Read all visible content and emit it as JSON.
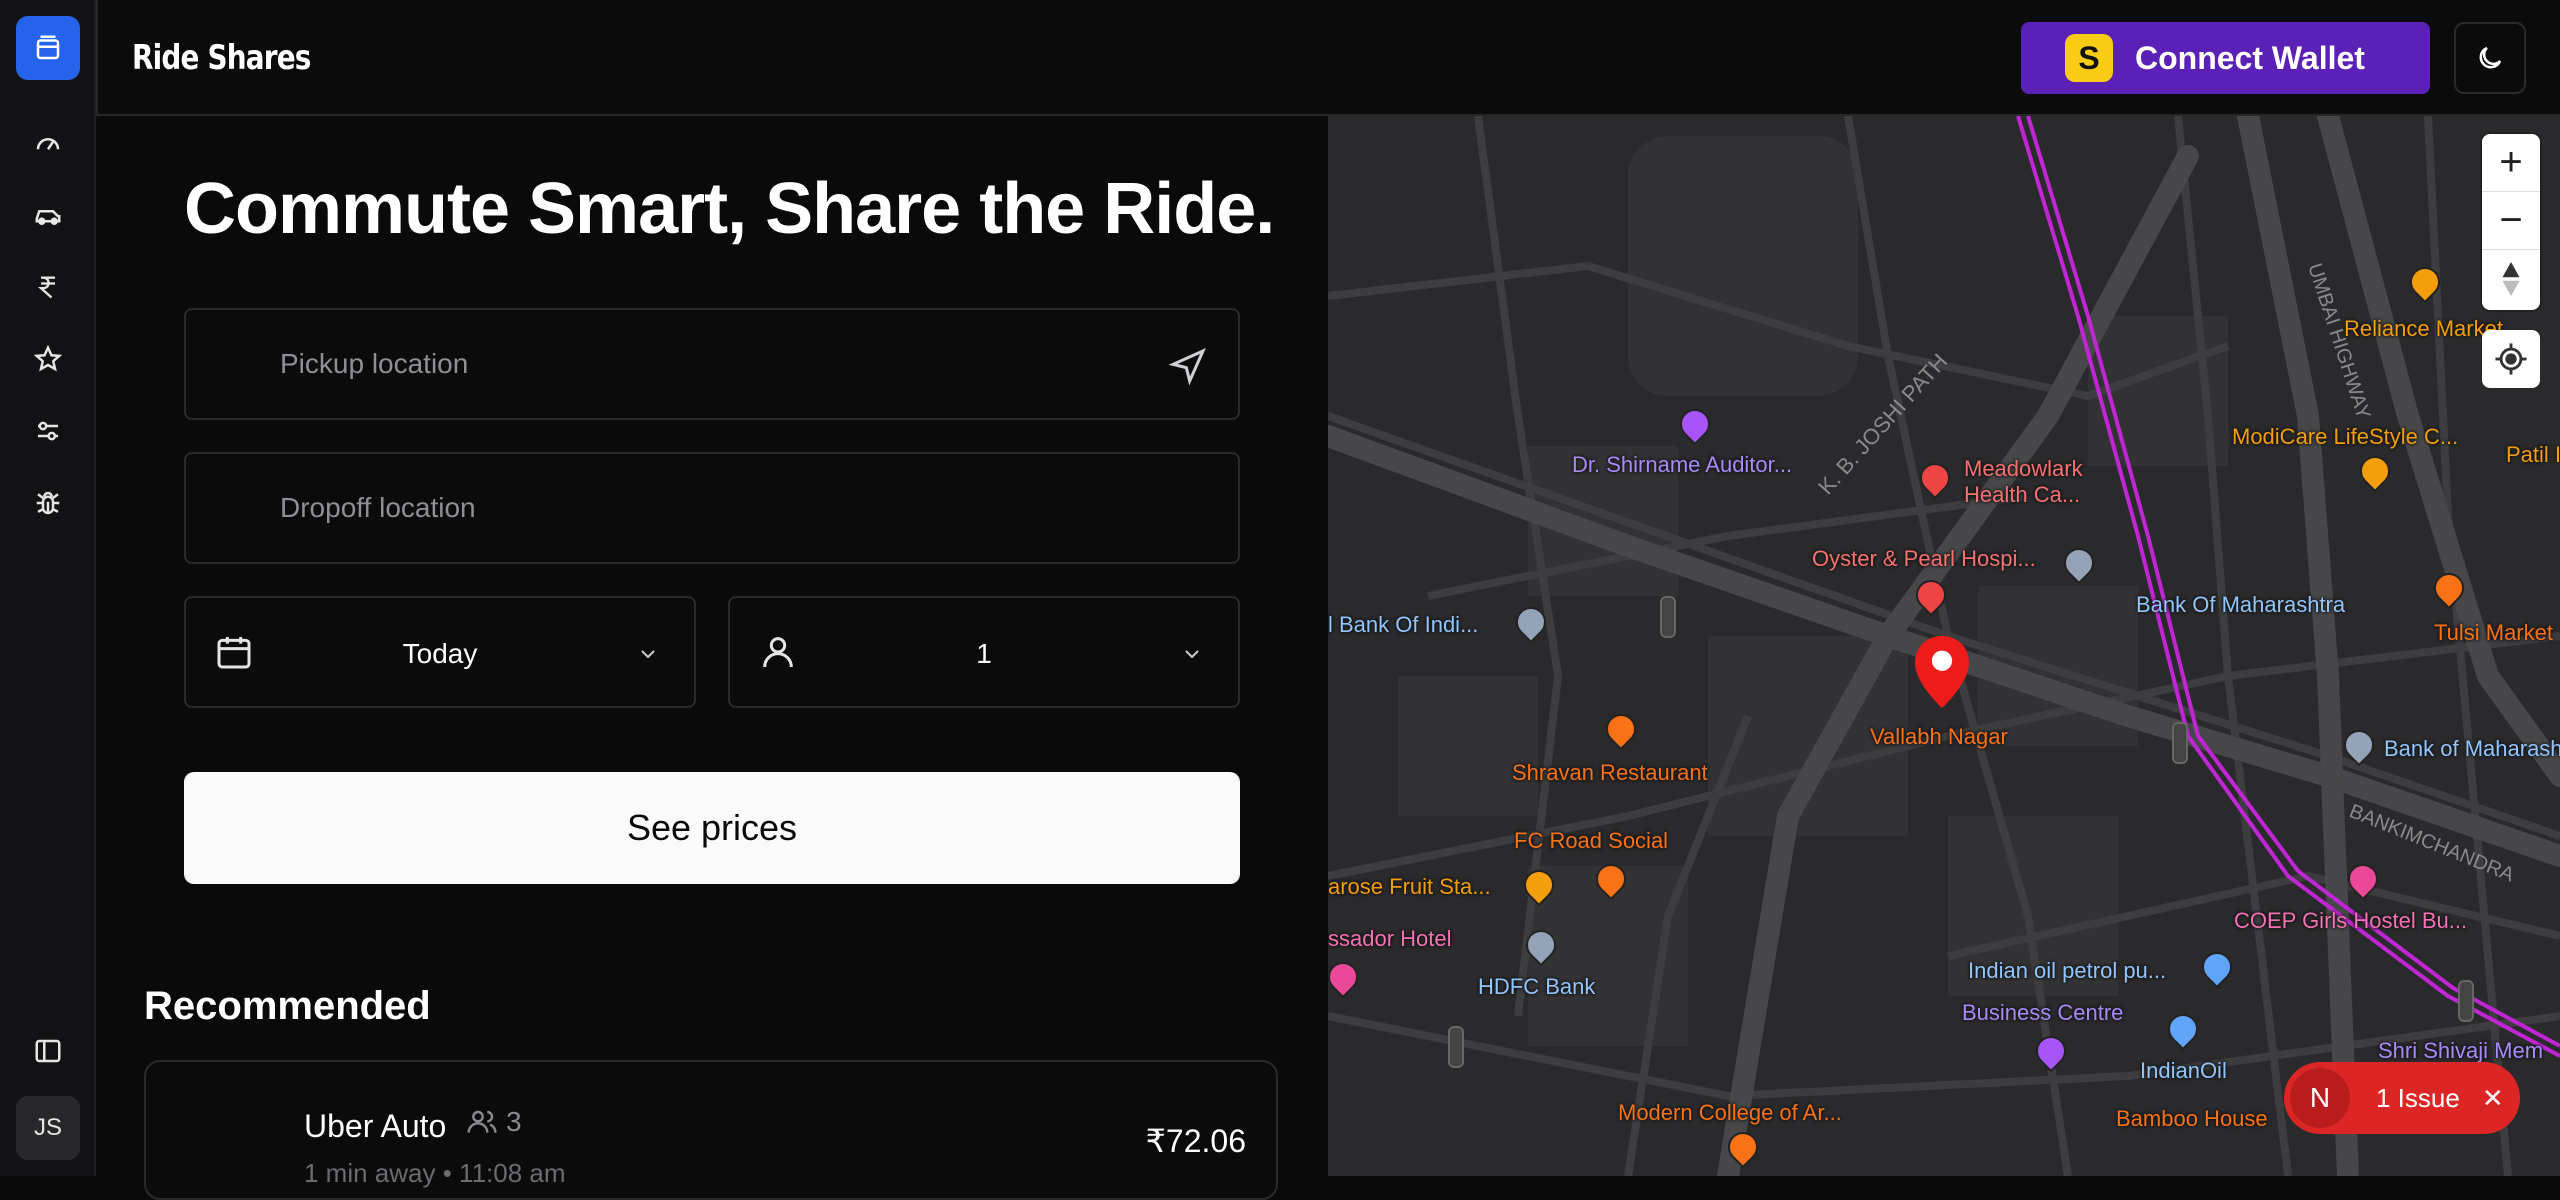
{
  "app": {
    "title": "Ride Shares"
  },
  "header": {
    "connect_wallet": "Connect Wallet",
    "wallet_icon_letter": "S"
  },
  "sidebar": {
    "items": [
      "dashboard-icon",
      "car-icon",
      "rupee-icon",
      "star-icon",
      "sliders-icon",
      "bug-icon"
    ],
    "avatar_initials": "JS"
  },
  "booking": {
    "headline": "Commute Smart, Share the Ride.",
    "pickup_placeholder": "Pickup location",
    "dropoff_placeholder": "Dropoff location",
    "date_value": "Today",
    "passengers_value": "1",
    "see_prices": "See prices"
  },
  "recommended": {
    "title": "Recommended",
    "rides": [
      {
        "name": "Uber Auto",
        "seats": "3",
        "meta": "1 min away • 11:08 am",
        "price": "₹72.06"
      }
    ]
  },
  "map": {
    "labels": {
      "reliance": "Reliance Market",
      "modicare": "ModiCare LifeStyle C...",
      "patil": "Patil I",
      "shirname": "Dr. Shirname Auditor...",
      "meadowlark1": "Meadowlark",
      "meadowlark2": "Health Ca...",
      "oyster": "Oyster & Pearl Hospi...",
      "bom1": "Bank Of Maharashtra",
      "tulsi": "Tulsi Market",
      "boi": "l Bank Of Indi...",
      "vallabh": "Vallabh Nagar",
      "bom2": "Bank of Maharashtra",
      "shravan": "Shravan Restaurant",
      "fc": "FC Road Social",
      "fruit": "arose Fruit Sta...",
      "coep": "COEP Girls Hostel Bu...",
      "ambassador": "ssador Hotel",
      "hdfc": "HDFC Bank",
      "iop": "Indian oil petrol pu...",
      "business": "Business Centre",
      "indianoil": "IndianOil",
      "shivaji": "Shri Shivaji Mem",
      "modern": "Modern College of Ar...",
      "bamboo": "Bamboo House",
      "road_joshi": "K. B. JOSHI PATH",
      "road_highway": "UMBAI HIGHWAY",
      "road_bankim": "BANKIMCHANDRA"
    },
    "zoom_in": "+",
    "zoom_out": "−"
  },
  "issue_badge": {
    "letter": "N",
    "text": "1 Issue",
    "close": "✕"
  }
}
